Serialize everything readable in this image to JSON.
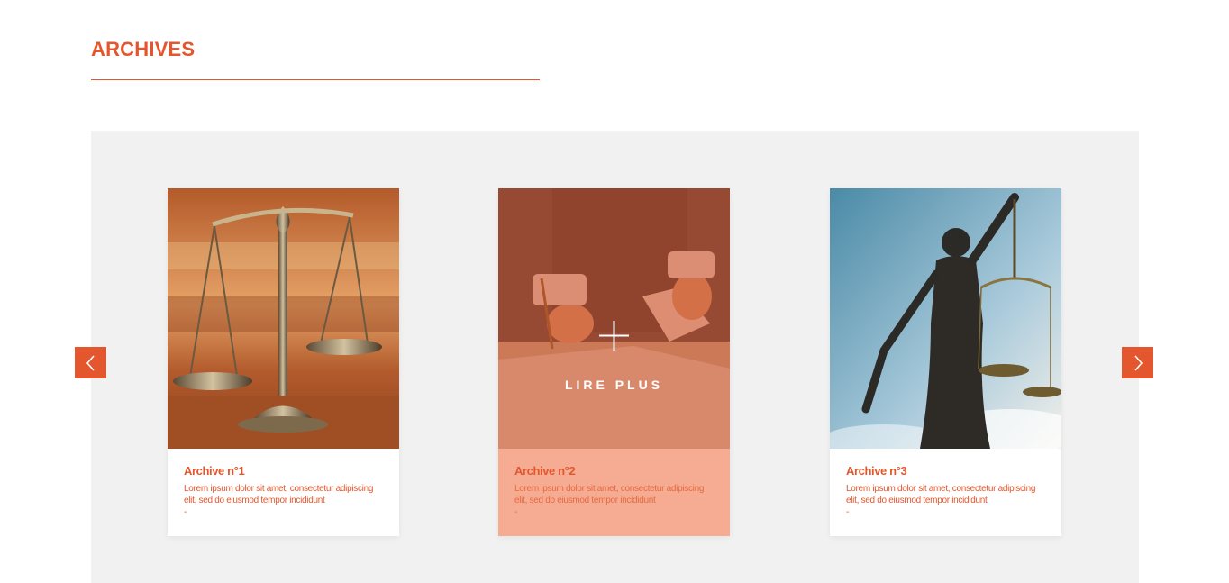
{
  "section": {
    "title": "ARCHIVES"
  },
  "colors": {
    "accent": "#e4572e",
    "panel": "#f1f1f1",
    "active_card": "#f5ac93"
  },
  "carousel": {
    "prev_icon": "chevron-left-icon",
    "next_icon": "chevron-right-icon",
    "cards": [
      {
        "title": "Archive n°1",
        "text": "Lorem ipsum dolor sit amet, consectetur adipiscing elit, sed do eiusmod tempor incididunt",
        "dash": "-",
        "image": "scales-of-justice-image"
      },
      {
        "title": "Archive n°2",
        "text": "Lorem ipsum dolor sit amet, consectetur adipiscing elit, sed do eiusmod tempor incididunt",
        "dash": "-",
        "image": "signing-documents-image",
        "overlay_label": "LIRE PLUS",
        "overlay_icon": "plus-icon"
      },
      {
        "title": "Archive n°3",
        "text": "Lorem ipsum dolor sit amet, consectetur adipiscing elit, sed do eiusmod tempor incididunt",
        "dash": "-",
        "image": "lady-justice-statue-image"
      }
    ]
  }
}
